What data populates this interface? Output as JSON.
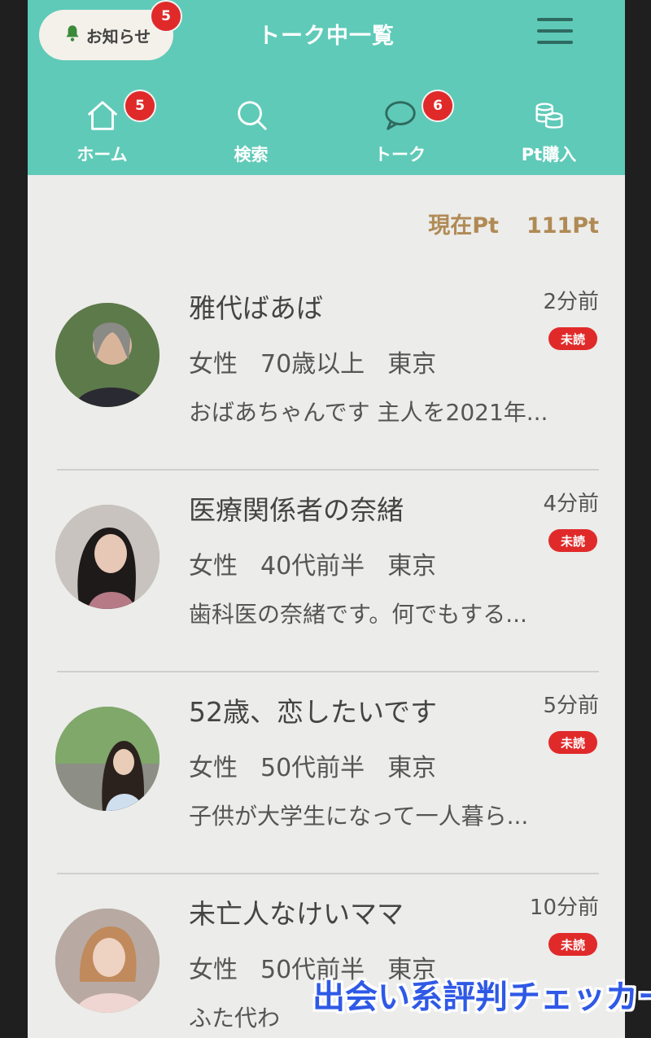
{
  "header": {
    "notice_label": "お知らせ",
    "notice_badge": "5",
    "title": "トーク中一覧"
  },
  "nav": [
    {
      "label": "ホーム",
      "icon": "home-icon",
      "badge": "5"
    },
    {
      "label": "検索",
      "icon": "search-icon",
      "badge": ""
    },
    {
      "label": "トーク",
      "icon": "chat-bubble-icon",
      "badge": "6"
    },
    {
      "label": "Pt購入",
      "icon": "coins-icon",
      "badge": ""
    }
  ],
  "points": {
    "label": "現在Pt",
    "value": "111Pt"
  },
  "talks": [
    {
      "name": "雅代ばあば",
      "time": "2分前",
      "status": "未読",
      "gender": "女性",
      "age": "70歳以上",
      "area": "東京",
      "message": "おばあちゃんです 主人を2021年..."
    },
    {
      "name": "医療関係者の奈緒",
      "time": "4分前",
      "status": "未読",
      "gender": "女性",
      "age": "40代前半",
      "area": "東京",
      "message": "歯科医の奈緒です。何でもする..."
    },
    {
      "name": "52歳、恋したいです",
      "time": "5分前",
      "status": "未読",
      "gender": "女性",
      "age": "50代前半",
      "area": "東京",
      "message": "子供が大学生になって一人暮ら..."
    },
    {
      "name": "未亡人なけいママ",
      "time": "10分前",
      "status": "未読",
      "gender": "女性",
      "age": "50代前半",
      "area": "東京",
      "message": "ふた代わ"
    }
  ],
  "watermark": "出会い系評判チェッカー",
  "colors": {
    "header": "#5fcab8",
    "badge": "#e02a2a",
    "points": "#b08a55",
    "watermark": "#2f59e6"
  }
}
